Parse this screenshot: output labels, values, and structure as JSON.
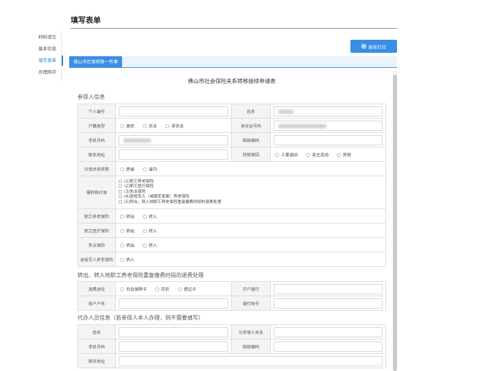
{
  "page": {
    "title": "填写表单",
    "print_label": "表单打印"
  },
  "nav": {
    "items": [
      "材料递交",
      "基本信息",
      "填写表单",
      "办理网点"
    ]
  },
  "tab": {
    "label": "佛山市社保转移一件事"
  },
  "form": {
    "title": "佛山市社会保险关系转移接续申请表"
  },
  "sections": {
    "insured": "参保人信息",
    "refund": "转出、转入地职工养老保险重复缴费时段的退费处理",
    "agent": "代办人员信息（若参保人本人办理，则不需要填写）"
  },
  "insured": {
    "personal_no": "个人编号",
    "name": "姓名",
    "hukou_type": "户籍类型",
    "hukou_options": [
      "居民",
      "农业",
      "非农业"
    ],
    "id_no": "身份证号码",
    "phone": "手机号码",
    "postcode": "邮政编码",
    "address": "联系地址",
    "reason": "转移原因",
    "reason_options": [
      "人事调动",
      "自主流动",
      "其他"
    ],
    "transfer": "社保关系转移",
    "transfer_options": [
      "跨省",
      "省内"
    ],
    "needed": "需转移社保",
    "needed_options": [
      "(1)职工养老保险",
      "(2)职工医疗保险",
      "(3)失业保险",
      "(4)退役军人（或随军家属）养老保险",
      "(5)转出、转入地职工养老保险重复缴费时段的退费处理"
    ],
    "pension": "职工养老保险",
    "medical": "职工医疗保险",
    "unemployment": "失业保险",
    "veteran": "退役军人养老保险",
    "out_in": [
      "转出",
      "转入"
    ],
    "in_only": [
      "转入"
    ]
  },
  "refund": {
    "method": "退费途径",
    "method_options": [
      "社会保障卡",
      "存折",
      "借记卡"
    ],
    "bank": "开户银行",
    "account_name": "账户户名",
    "account_no": "银行账号"
  },
  "agent": {
    "name": "姓名",
    "relation": "与参保人关系",
    "phone": "手机号码",
    "postcode": "邮政编码",
    "address": "联系地址"
  },
  "colors": {
    "accent": "#3a8ee6",
    "label_bg": "#f4f4f4",
    "tab_bg": "#eaf3fb"
  }
}
